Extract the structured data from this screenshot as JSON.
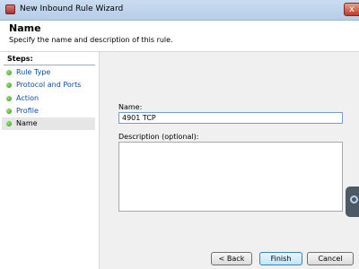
{
  "window": {
    "title": "New Inbound Rule Wizard",
    "close_glyph": "x"
  },
  "header": {
    "title": "Name",
    "subtitle": "Specify the name and description of this rule."
  },
  "steps": {
    "heading": "Steps:",
    "items": [
      {
        "label": "Rule Type"
      },
      {
        "label": "Protocol and Ports"
      },
      {
        "label": "Action"
      },
      {
        "label": "Profile"
      },
      {
        "label": "Name",
        "current": true
      }
    ]
  },
  "form": {
    "name_label": "Name:",
    "name_value": "4901 TCP",
    "description_label": "Description (optional):",
    "description_value": ""
  },
  "buttons": {
    "back": "< Back",
    "finish": "Finish",
    "cancel": "Cancel"
  },
  "colors": {
    "step_link": "#0b4ea2",
    "step_dot": "#2c9a12"
  }
}
